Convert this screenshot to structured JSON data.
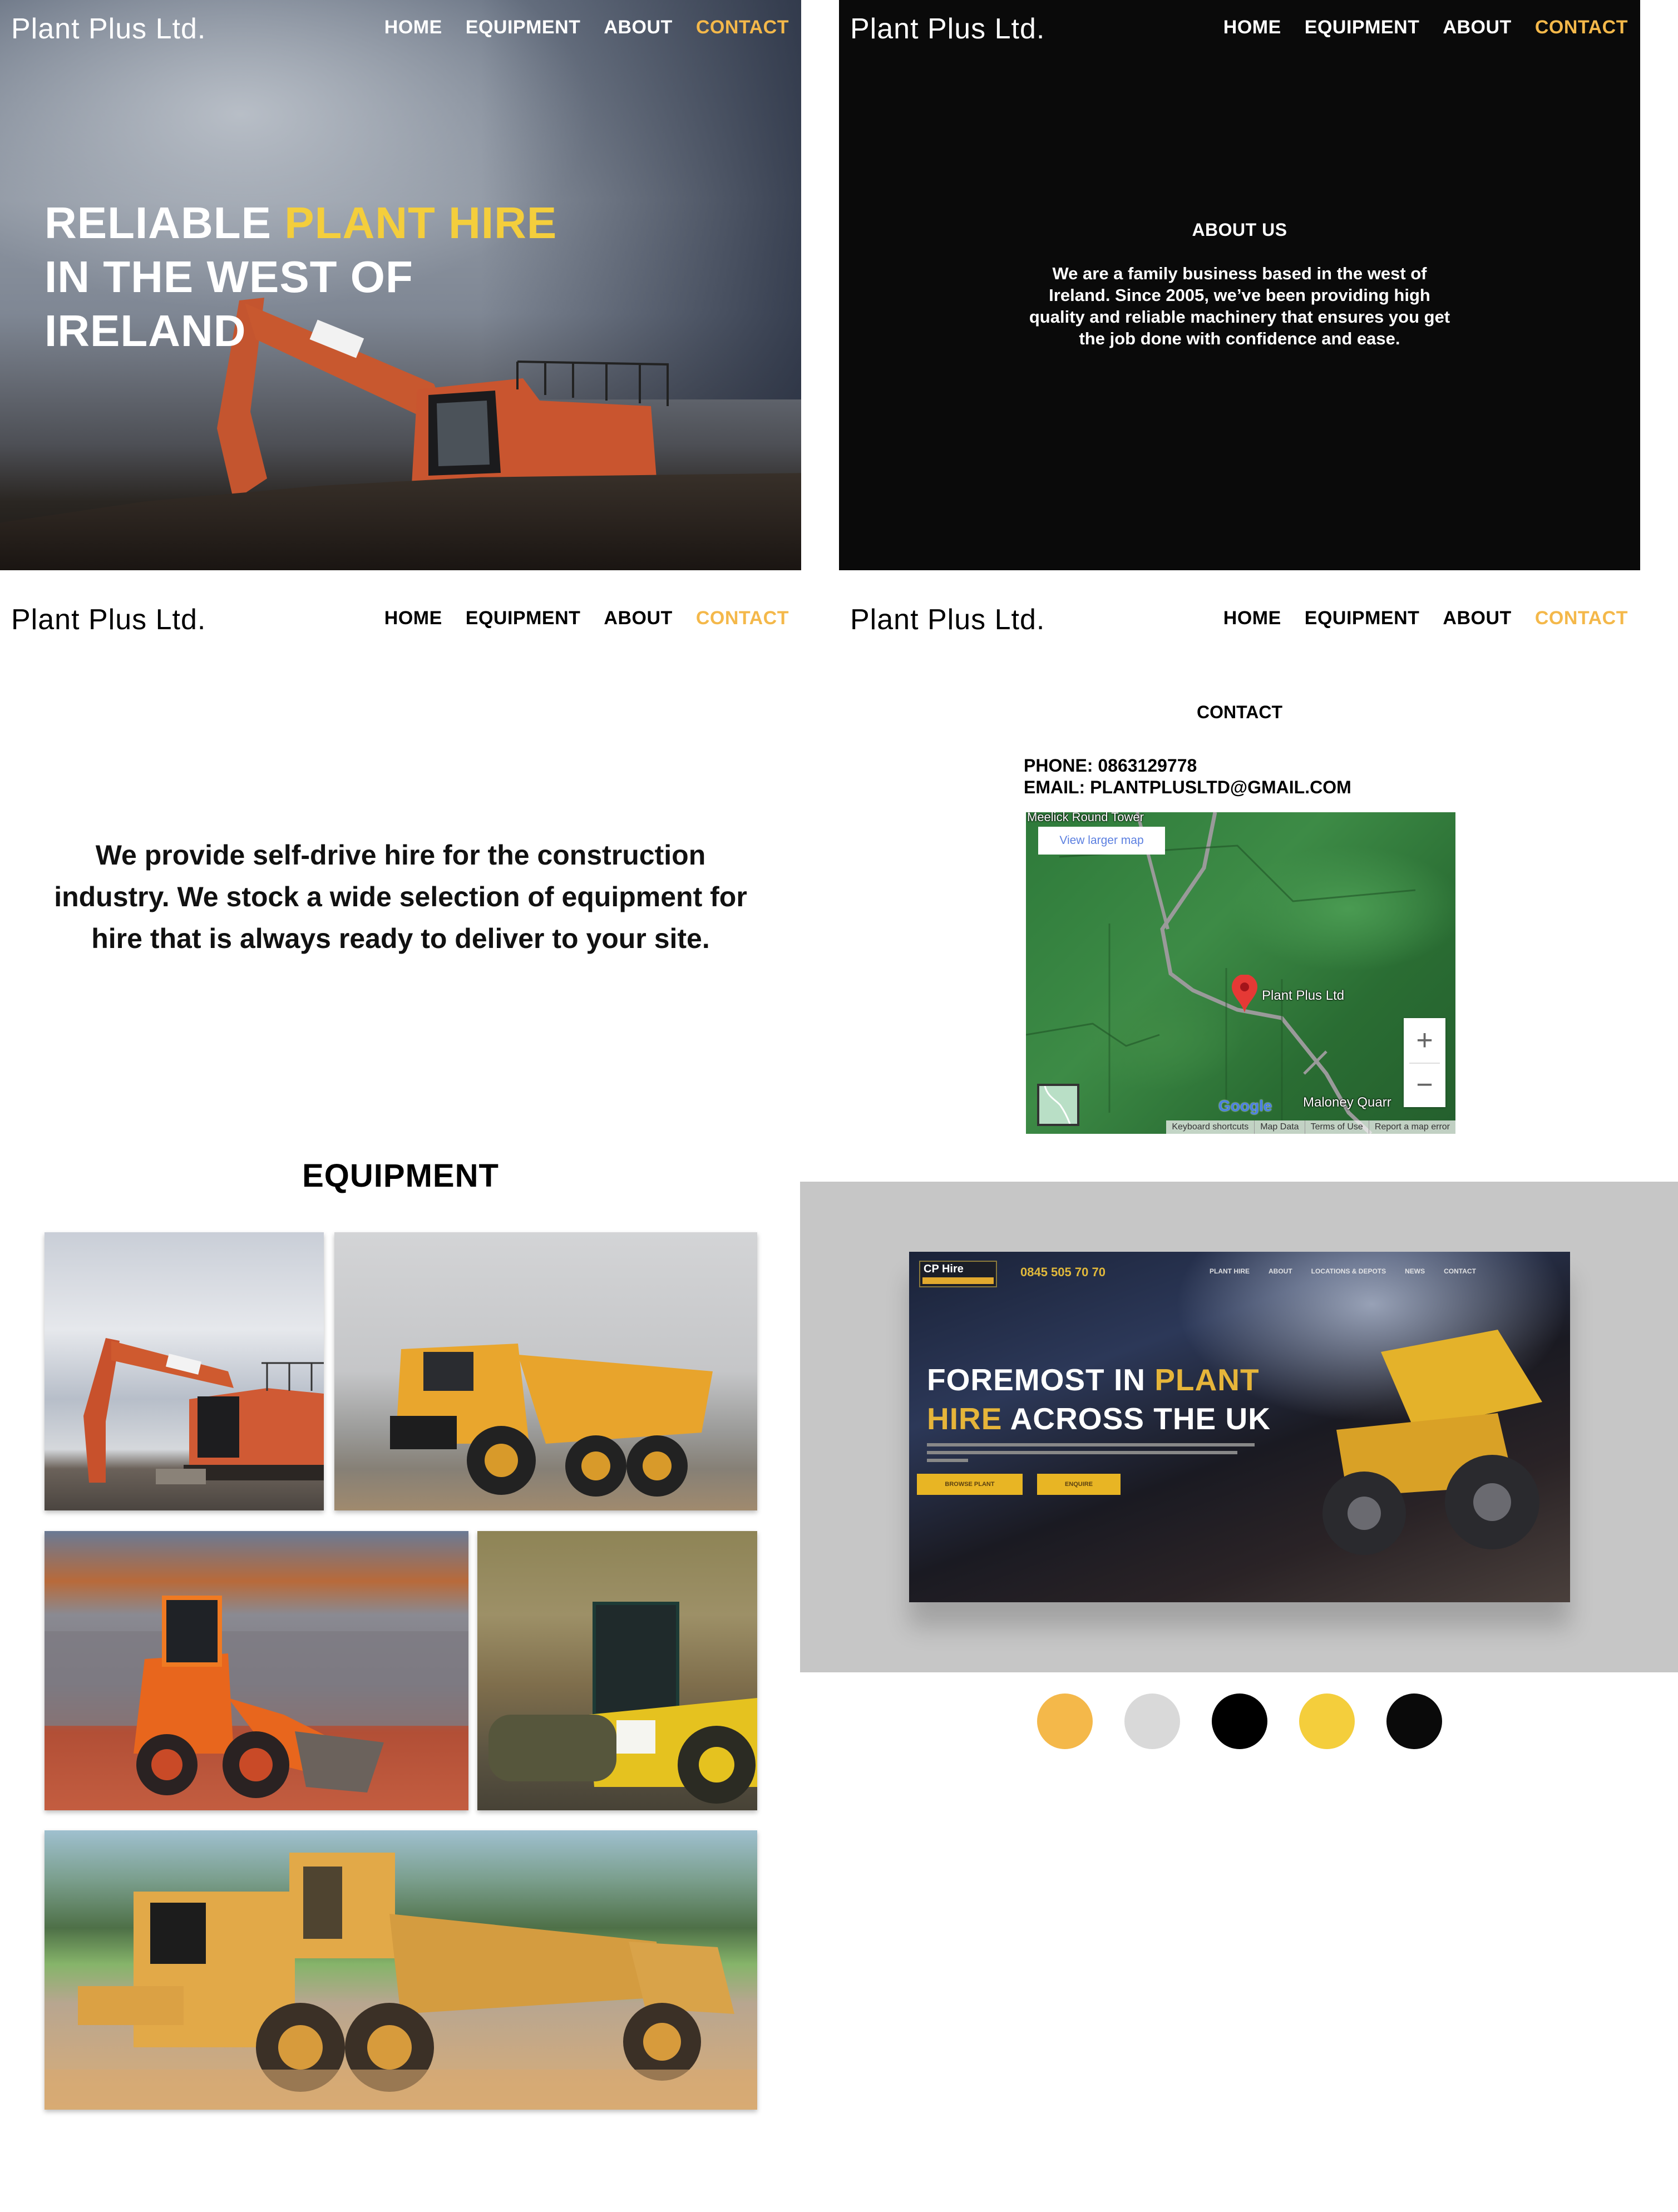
{
  "brand": {
    "name": "Plant Plus Ltd.",
    "accent_color": "#F4B84A",
    "highlight_color": "#F4CE3C"
  },
  "nav": {
    "items": [
      {
        "label": "HOME",
        "active": false
      },
      {
        "label": "EQUIPMENT",
        "active": false
      },
      {
        "label": "ABOUT",
        "active": false
      },
      {
        "label": "CONTACT",
        "active": true
      }
    ]
  },
  "hero": {
    "line1_white": "RELIABLE ",
    "line1_highlight": "PLANT HIRE",
    "line2": "IN THE WEST OF",
    "line3": "IRELAND",
    "image": "excavator-on-hill"
  },
  "about": {
    "title": "ABOUT US",
    "body": "We are a family business based in the west of Ireland. Since 2005, we’ve been providing high quality and reliable machinery that ensures you get the job done with confidence and ease."
  },
  "intro": {
    "text": "We provide self-drive hire for the construction industry. We stock a wide selection of equipment for hire that is always ready to deliver to your site."
  },
  "equipment": {
    "title": "EQUIPMENT",
    "photos": [
      {
        "name": "excavator",
        "alt": "Orange excavator"
      },
      {
        "name": "articulated-dump-truck",
        "alt": "Yellow articulated dump truck"
      },
      {
        "name": "wheel-loader",
        "alt": "Orange wheel loader"
      },
      {
        "name": "road-roller",
        "alt": "Yellow road roller"
      },
      {
        "name": "motor-grader",
        "alt": "CAT motor grader"
      }
    ]
  },
  "contact": {
    "title": "CONTACT",
    "phone": "PHONE: 0863129778",
    "email": "EMAIL: PLANTPLUSLTD@GMAIL.COM",
    "map": {
      "top_label": "Meelick Round Tower",
      "view_larger": "View larger map",
      "pin_label": "Plant Plus Ltd",
      "bottom_label": "Maloney Quarr",
      "google": "Google",
      "zoom_in": "+",
      "zoom_out": "−",
      "footer": [
        "Keyboard shortcuts",
        "Map Data",
        "Terms of Use",
        "Report a map error"
      ]
    }
  },
  "mockup": {
    "logo": "CP Hire",
    "phone": "0845 505 70 70",
    "nav": [
      "PLANT HIRE",
      "ABOUT",
      "LOCATIONS & DEPOTS",
      "NEWS",
      "CONTACT"
    ],
    "headline_l1_white": "FOREMOST IN ",
    "headline_l1_yellow": "PLANT",
    "headline_l2_yellow": "HIRE",
    "headline_l2_white": " ACROSS THE UK",
    "buttons": [
      "BROWSE PLANT",
      "ENQUIRE"
    ]
  },
  "palette": [
    "#F4B84A",
    "#D9D9D9",
    "#000000",
    "#F4CE3C",
    "#0A0A0A"
  ]
}
